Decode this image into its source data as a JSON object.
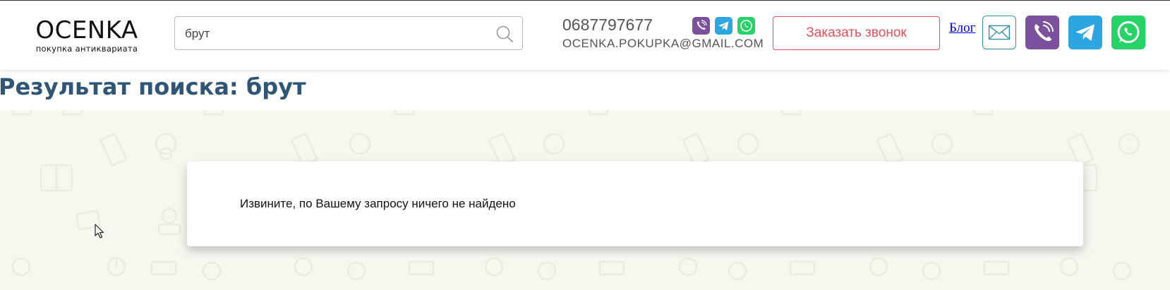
{
  "logo": {
    "name": "OCENKA",
    "tagline": "покупка антиквариата"
  },
  "search": {
    "value": "брут"
  },
  "contact": {
    "phone": "0687797677",
    "email": "OCENKA.POKUPKA@GMAIL.COM"
  },
  "header": {
    "callback_label": "Заказать звонок",
    "blog_label": "Блог"
  },
  "page": {
    "title": "Результат поиска: брут",
    "empty_message": "Извините, по Вашему запросу ничего не найдено"
  },
  "colors": {
    "viber": "#7b519d",
    "telegram": "#2ca5e0",
    "whatsapp": "#25d366",
    "title": "#2f5577",
    "accent_red": "#e4505a",
    "background": "#f7f7f0"
  },
  "icons": [
    "search-icon",
    "viber-icon",
    "telegram-icon",
    "whatsapp-icon",
    "mail-icon",
    "cursor-icon"
  ]
}
